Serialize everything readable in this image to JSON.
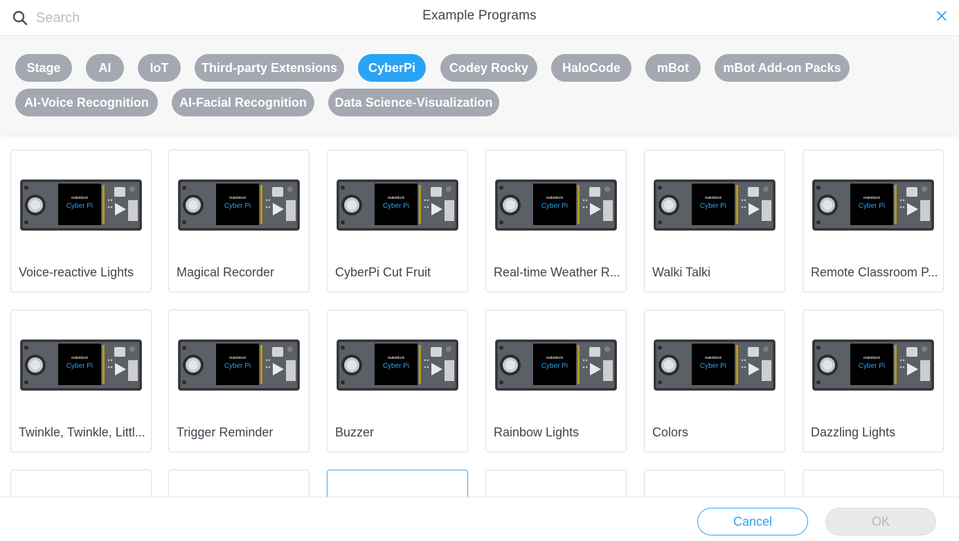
{
  "header": {
    "title": "Example Programs",
    "search_placeholder": "Search"
  },
  "categories": [
    {
      "label": "Stage"
    },
    {
      "label": "AI"
    },
    {
      "label": "IoT"
    },
    {
      "label": "Third-party Extensions"
    },
    {
      "label": "CyberPi",
      "active": true
    },
    {
      "label": "Codey Rocky"
    },
    {
      "label": "HaloCode"
    },
    {
      "label": "mBot"
    },
    {
      "label": "mBot Add-on Packs"
    },
    {
      "label": "AI-Voice Recognition"
    },
    {
      "label": "AI-Facial Recognition"
    },
    {
      "label": "Data Science-Visualization"
    }
  ],
  "device": {
    "brand": "makeblock",
    "name": "Cyber Pi"
  },
  "programs": [
    {
      "label": "Voice-reactive Lights"
    },
    {
      "label": "Magical Recorder"
    },
    {
      "label": "CyberPi Cut Fruit"
    },
    {
      "label": "Real-time Weather R..."
    },
    {
      "label": "Walki Talki"
    },
    {
      "label": "Remote Classroom P..."
    },
    {
      "label": "Twinkle, Twinkle, Littl..."
    },
    {
      "label": "Trigger Reminder"
    },
    {
      "label": "Buzzer"
    },
    {
      "label": "Rainbow Lights"
    },
    {
      "label": "Colors"
    },
    {
      "label": "Dazzling Lights"
    }
  ],
  "footer": {
    "cancel_label": "Cancel",
    "ok_label": "OK"
  },
  "colors": {
    "accent": "#2aa3f5",
    "chip_inactive": "#a4a8b1"
  }
}
